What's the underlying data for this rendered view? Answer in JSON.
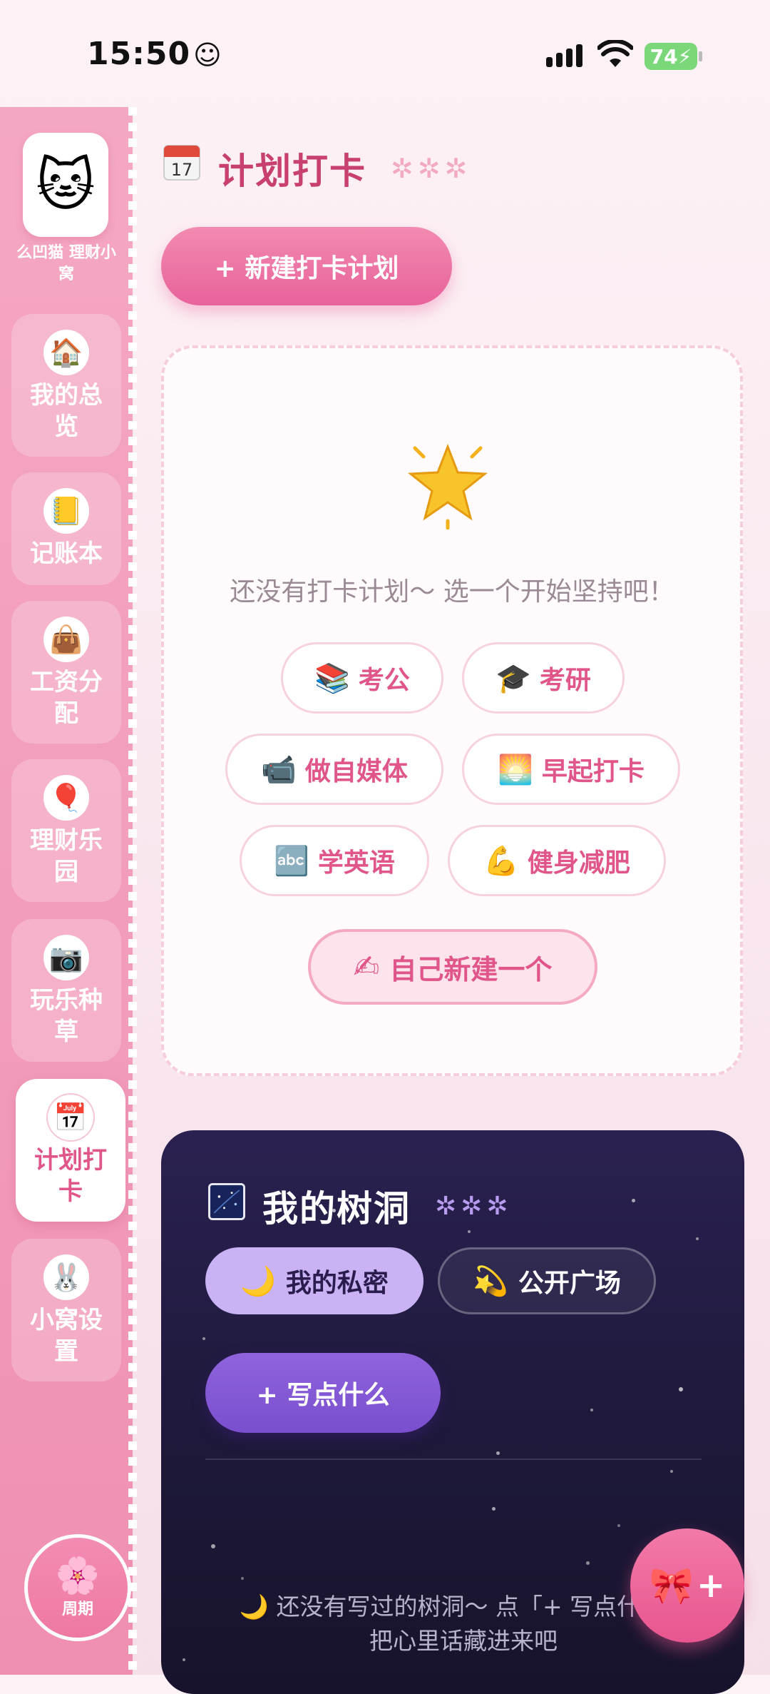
{
  "status_bar": {
    "time": "15:50",
    "time_emoji": "☺",
    "battery": "74"
  },
  "sidebar": {
    "app_name": "么凹猫 理财小窝",
    "logo_icon": "hello-kitty-logo",
    "items": [
      {
        "label": "我的总览",
        "icon": "kitty-house-icon",
        "glyph": "🏠"
      },
      {
        "label": "记账本",
        "icon": "kitty-notebook-icon",
        "glyph": "📒"
      },
      {
        "label": "工资分配",
        "icon": "kitty-bag-icon",
        "glyph": "👜"
      },
      {
        "label": "理财乐园",
        "icon": "kitty-balloon-icon",
        "glyph": "🎈"
      },
      {
        "label": "玩乐种草",
        "icon": "kitty-camera-icon",
        "glyph": "📷"
      },
      {
        "label": "计划打卡",
        "icon": "kitty-calendar-icon",
        "glyph": "📅"
      },
      {
        "label": "小窝设置",
        "icon": "kitty-bunny-icon",
        "glyph": "🐰"
      }
    ],
    "active_index": 5,
    "cycle_label": "周期",
    "cycle_icon": "🌸"
  },
  "header": {
    "title": "计划打卡",
    "stars": "✲✲✲"
  },
  "new_plan_button": "+ 新建打卡计划",
  "plans_card": {
    "empty_text": "还没有打卡计划～ 选一个开始坚持吧！",
    "chips": [
      {
        "label": "考公",
        "icon": "📚"
      },
      {
        "label": "考研",
        "icon": "🎓"
      },
      {
        "label": "做自媒体",
        "icon": "📹"
      },
      {
        "label": "早起打卡",
        "icon": "🌅"
      },
      {
        "label": "学英语",
        "icon": "🔤"
      },
      {
        "label": "健身减肥",
        "icon": "💪"
      }
    ],
    "custom": {
      "label": "自己新建一个",
      "icon": "✍"
    }
  },
  "tree_hole": {
    "title": "我的树洞",
    "stars": "✲✲✲",
    "tab_private": {
      "label": "我的私密",
      "icon": "🌙"
    },
    "tab_public": {
      "label": "公开广场",
      "icon": "💫"
    },
    "write_button": "+ 写点什么",
    "empty_line1": "🌙 还没有写过的树洞～ 点「+ 写点什么」",
    "empty_line2": "把心里话藏进来吧"
  },
  "fab": {
    "icon": "🎀",
    "plus": "+"
  },
  "colors": {
    "accent": "#e0568a",
    "sidebar": "#f29bbb",
    "tree_bg": "#1d1838",
    "purple": "#8f63dc"
  }
}
